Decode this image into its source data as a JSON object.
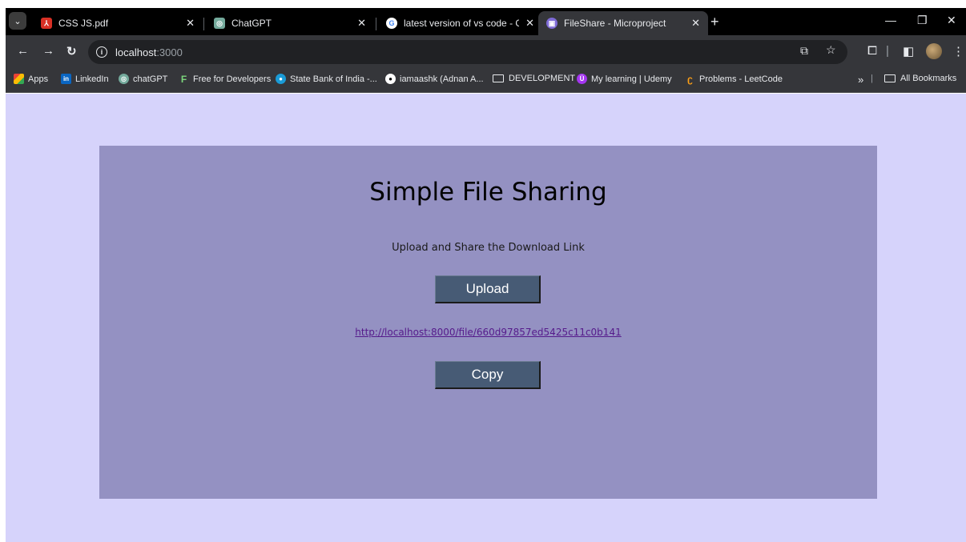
{
  "browser": {
    "tabs": [
      {
        "title": "CSS JS.pdf",
        "active": false
      },
      {
        "title": "ChatGPT",
        "active": false
      },
      {
        "title": "latest version of vs code - Goog",
        "active": false
      },
      {
        "title": "FileShare - Microproject",
        "active": true
      }
    ],
    "address": {
      "host": "localhost",
      "port": ":3000"
    },
    "bookmarks": [
      "Apps",
      "LinkedIn",
      "chatGPT",
      "Free for Developers",
      "State Bank of India -...",
      "iamaashk (Adnan A...",
      "DEVELOPMENT",
      "My learning | Udemy",
      "Problems - LeetCode"
    ],
    "all_bookmarks": "All Bookmarks",
    "overflow": "»"
  },
  "page": {
    "title": "Simple File Sharing",
    "subtitle": "Upload and Share the Download Link",
    "upload_label": "Upload",
    "download_link": "http://localhost:8000/file/660d97857ed5425c11c0b141",
    "copy_label": "Copy"
  },
  "colors": {
    "page_background": "#d6d3fb",
    "card_background": "#9491c2",
    "button_background": "#475b75",
    "link": "#551a8b"
  }
}
